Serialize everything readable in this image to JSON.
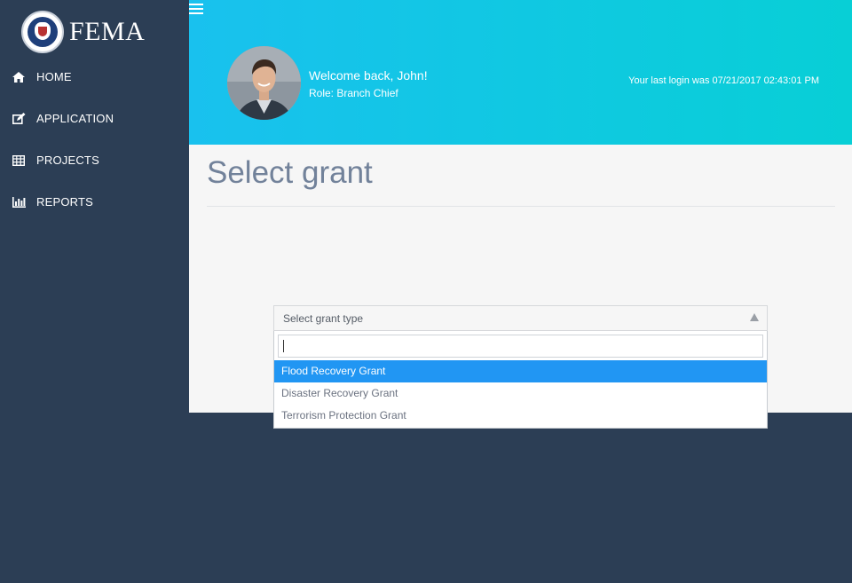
{
  "brand": {
    "name": "FEMA",
    "logo_icon": "dhs-seal-icon"
  },
  "sidebar": {
    "items": [
      {
        "label": "HOME",
        "icon": "home-icon"
      },
      {
        "label": "APPLICATION",
        "icon": "edit-icon"
      },
      {
        "label": "PROJECTS",
        "icon": "table-icon"
      },
      {
        "label": "REPORTS",
        "icon": "bar-chart-icon"
      }
    ]
  },
  "header": {
    "menu_icon": "hamburger-icon",
    "welcome": "Welcome back, John!",
    "role": "Role: Branch Chief",
    "last_login": "Your last login was 07/21/2017 02:43:01 PM",
    "gradient": [
      "#19c1ee",
      "#08cfd6"
    ]
  },
  "main": {
    "title": "Select grant",
    "select": {
      "placeholder": "Select grant type",
      "search_value": "",
      "options": [
        {
          "label": "Flood Recovery Grant",
          "highlighted": true
        },
        {
          "label": "Disaster Recovery Grant",
          "highlighted": false
        },
        {
          "label": "Terrorism Protection Grant",
          "highlighted": false
        }
      ]
    }
  },
  "colors": {
    "sidebar": "#2c3e55",
    "highlight": "#2196f3",
    "title": "#72829a"
  }
}
